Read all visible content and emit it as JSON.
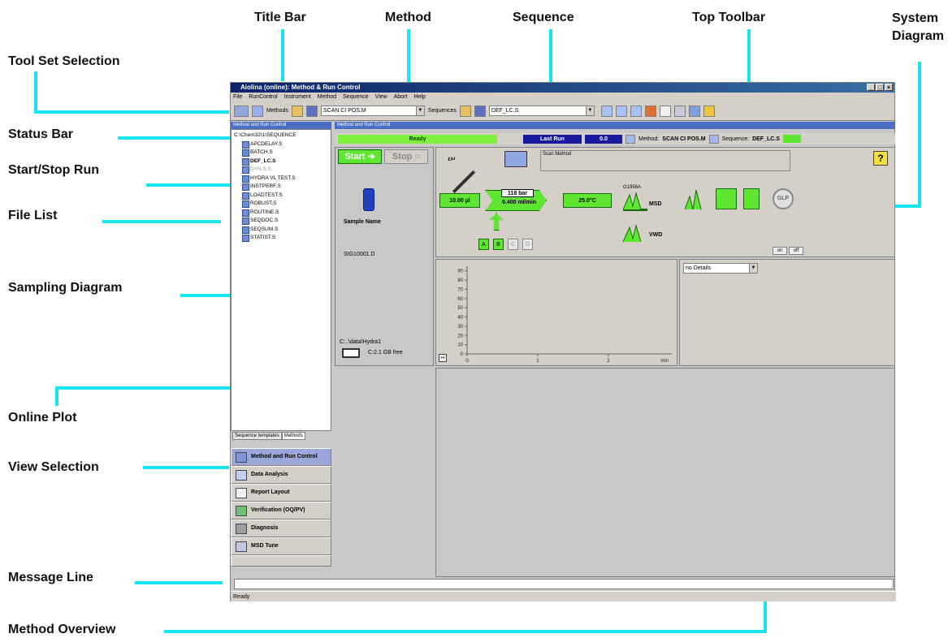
{
  "callouts": {
    "title_bar": "Title Bar",
    "method": "Method",
    "sequence": "Sequence",
    "top_toolbar": "Top Toolbar",
    "system_diagram": "System\nDiagram",
    "tool_set_selection": "Tool Set Selection",
    "status_bar": "Status Bar",
    "start_stop_run": "Start/Stop Run",
    "file_list": "File List",
    "sampling_diagram": "Sampling Diagram",
    "online_plot": "Online Plot",
    "view_selection": "View Selection",
    "message_line": "Message Line",
    "method_overview": "Method Overview"
  },
  "window": {
    "title": "Aiolina (online): Method & Run Control",
    "menu": [
      "File",
      "RunControl",
      "Instrument",
      "Method",
      "Sequence",
      "View",
      "Abort",
      "Help"
    ],
    "toolbar": {
      "methods_label": "Methods",
      "method_value": "SCAN CI POS.M",
      "sequences_label": "Sequences",
      "sequence_value": "DEF_LC.S"
    }
  },
  "left_panel": {
    "header": "Method and Run Control",
    "root": "C:\\Chem32\\1\\SEQUENCE",
    "files": [
      "APCDELAY.S",
      "BATCH.S",
      "DEF_LC.S",
      "DYN.S.S",
      "HYDRA VL TEST.S",
      "INSTPERF.S",
      "LOADTEST.S",
      "ROBUST.S",
      "ROUTINE.S",
      "SEQDOC.S",
      "SEQSUM.S",
      "STATIST.S"
    ],
    "tabs": [
      "Sequence templates",
      "Methods"
    ],
    "views": [
      "Method and Run Control",
      "Data Analysis",
      "Report Layout",
      "Verification (OQ/PV)",
      "Diagnosis",
      "MSD Tune"
    ]
  },
  "main": {
    "header": "Method and Run Control",
    "status": {
      "ready": "Ready",
      "last_run": "Last Run",
      "last_value": "0.0",
      "method_label": "Method:",
      "method_value": "SCAN CI POS.M",
      "sequence_label": "Sequence:",
      "sequence_value": "DEF_LC.S"
    },
    "start": "Start",
    "stop": "Stop",
    "sample_name_label": "Sample Name",
    "sample_file": "SIG10001.D",
    "data_path": "C:..\\data\\Hydra1",
    "disk_free": "C:2.1 GB free",
    "scan_method": "Scan Method",
    "injector_volume": "10.00 µl",
    "pressure": "118 bar",
    "flow": "0.400 ml/min",
    "temp": "25.0°C",
    "detector_model": "G1956A",
    "msd_label": "MSD",
    "vwd_label": "VWD",
    "glp_label": "GLP",
    "bottles": [
      "A",
      "B",
      "C",
      "D"
    ],
    "on_label": "on",
    "off_label": "off",
    "details_select": "no Details",
    "status_text": "Ready"
  },
  "chart_data": {
    "type": "line",
    "title": "",
    "xlabel": "min",
    "ylabel": "",
    "x_ticks": [
      0,
      1,
      2
    ],
    "y_ticks": [
      0,
      10,
      20,
      30,
      40,
      50,
      60,
      70,
      80,
      90
    ],
    "xlim": [
      0,
      2.9
    ],
    "ylim": [
      0,
      95
    ],
    "series": [],
    "grid": false
  }
}
